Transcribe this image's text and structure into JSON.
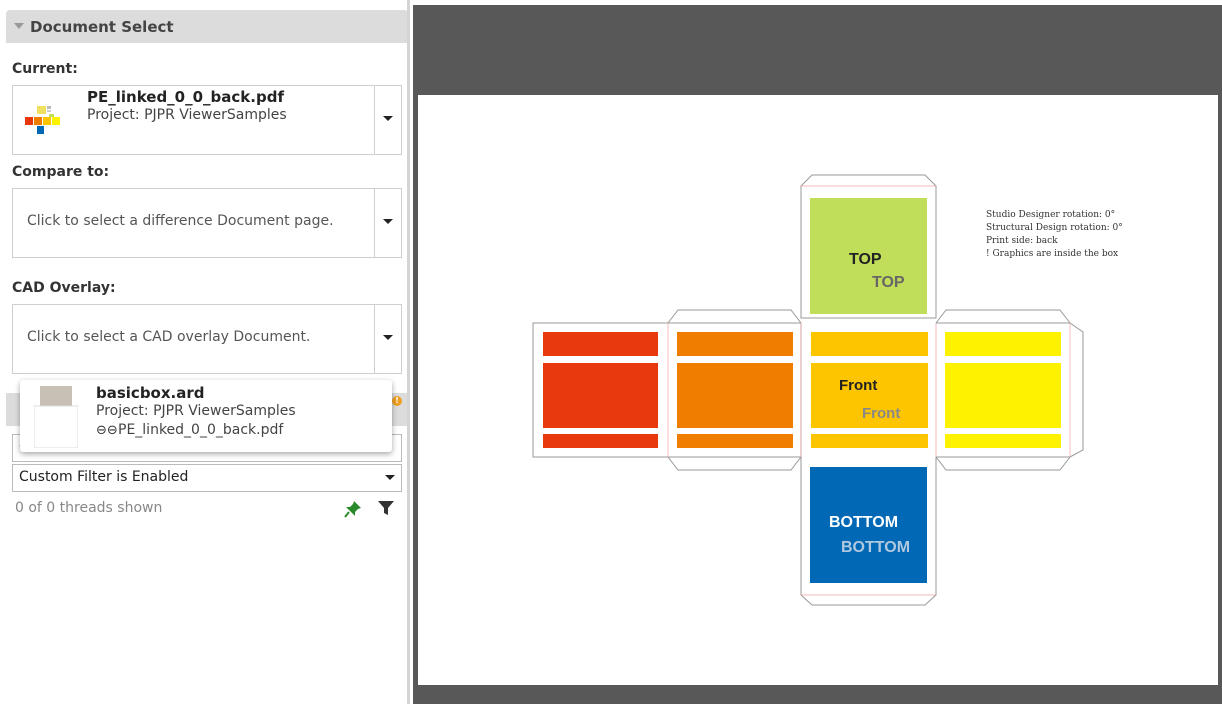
{
  "panel": {
    "title": "Document Select",
    "current_label": "Current:",
    "current_doc": {
      "name": "PE_linked_0_0_back.pdf",
      "project": "Project: PJPR ViewerSamples"
    },
    "compare_label": "Compare to:",
    "compare_placeholder": "Click to select a difference Document page.",
    "cad_label": "CAD Overlay:",
    "cad_placeholder": "Click to select a CAD overlay Document."
  },
  "popup": {
    "name": "basicbox.ard",
    "project": "Project: PJPR ViewerSamples",
    "linked": "PE_linked_0_0_back.pdf",
    "link_icon": "link-icon"
  },
  "threads": {
    "filter_hidden": "Custom Filter is Enabled",
    "filter_value": "Custom Filter is Enabled",
    "count_text": "0 of 0 threads shown",
    "badge": "!"
  },
  "artwork": {
    "top_label": "TOP",
    "top_label2": "TOP",
    "front_label": "Front",
    "front_label2": "Front",
    "bottom_label": "BOTTOM",
    "bottom_label2": "BOTTOM",
    "notes": [
      "Studio Designer rotation: 0°",
      "Structural Design rotation: 0°",
      "Print side: back",
      "! Graphics are inside the box"
    ]
  },
  "colors": {
    "red": "#e8380d",
    "orange": "#f07d00",
    "amber": "#fdc400",
    "yellow": "#fff200",
    "green": "#c1de5a",
    "blue": "#0068b4"
  }
}
